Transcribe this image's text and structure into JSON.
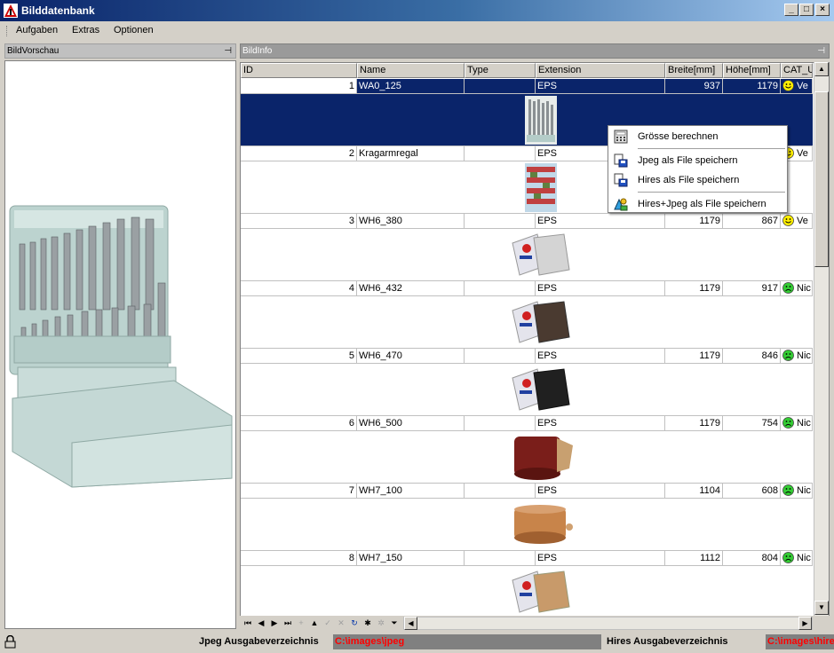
{
  "window": {
    "title": "Bilddatenbank",
    "minimize": "_",
    "maximize": "□",
    "close": "×"
  },
  "menu": {
    "items": [
      "Aufgaben",
      "Extras",
      "Optionen"
    ]
  },
  "preview_panel": {
    "title": "BildVorschau",
    "pin": "⊣"
  },
  "grid_panel": {
    "title": "BildInfo",
    "pin": "⊣"
  },
  "grid": {
    "columns": [
      "ID",
      "Name",
      "Type",
      "Extension",
      "Breite[mm]",
      "Höhe[mm]",
      "CAT_U"
    ],
    "rows": [
      {
        "id": "1",
        "name": "WA0_125",
        "type": "",
        "ext": "EPS",
        "breite": "937",
        "hoehe": "1179",
        "cat": "Ve",
        "mood": "happy",
        "selected": true
      },
      {
        "id": "2",
        "name": "Kragarmregal",
        "type": "",
        "ext": "EPS",
        "breite": "",
        "hoehe": "",
        "cat": "Ve",
        "mood": "happy",
        "selected": false
      },
      {
        "id": "3",
        "name": "WH6_380",
        "type": "",
        "ext": "EPS",
        "breite": "1179",
        "hoehe": "867",
        "cat": "Ve",
        "mood": "happy",
        "selected": false
      },
      {
        "id": "4",
        "name": "WH6_432",
        "type": "",
        "ext": "EPS",
        "breite": "1179",
        "hoehe": "917",
        "cat": "Nic",
        "mood": "sad",
        "selected": false
      },
      {
        "id": "5",
        "name": "WH6_470",
        "type": "",
        "ext": "EPS",
        "breite": "1179",
        "hoehe": "846",
        "cat": "Nic",
        "mood": "sad",
        "selected": false
      },
      {
        "id": "6",
        "name": "WH6_500",
        "type": "",
        "ext": "EPS",
        "breite": "1179",
        "hoehe": "754",
        "cat": "Nic",
        "mood": "sad",
        "selected": false
      },
      {
        "id": "7",
        "name": "WH7_100",
        "type": "",
        "ext": "EPS",
        "breite": "1104",
        "hoehe": "608",
        "cat": "Nic",
        "mood": "sad",
        "selected": false
      },
      {
        "id": "8",
        "name": "WH7_150",
        "type": "",
        "ext": "EPS",
        "breite": "1112",
        "hoehe": "804",
        "cat": "Nic",
        "mood": "sad",
        "selected": false
      }
    ]
  },
  "navigator": {
    "buttons": [
      "⏮",
      "◀",
      "▶",
      "⏭",
      "+",
      "▲",
      "✓",
      "✕",
      "↻",
      "✱",
      "✲",
      "⏷"
    ]
  },
  "context_menu": {
    "items": [
      {
        "label": "Grösse berechnen",
        "icon": "calculator-icon"
      },
      {
        "label": "Jpeg als File speichern",
        "icon": "save-jpeg-icon"
      },
      {
        "label": "Hires als File speichern",
        "icon": "save-hires-icon"
      },
      {
        "label": "Hires+Jpeg als File speichern",
        "icon": "save-both-icon"
      }
    ]
  },
  "status": {
    "lock_icon": "lock-icon",
    "jpeg_label": "Jpeg Ausgabeverzeichnis",
    "jpeg_path": "C:\\images\\jpeg",
    "hires_label": "Hires Ausgabeverzeichnis",
    "hires_path": "C:\\images\\hires"
  },
  "colors": {
    "selection": "#0a246a",
    "status_path_text": "#ff0000",
    "happy_face": "#ffee00",
    "sad_face": "#33cc33"
  }
}
